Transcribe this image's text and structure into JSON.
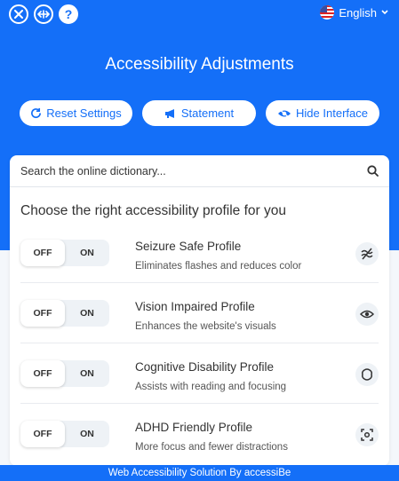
{
  "language": {
    "label": "English"
  },
  "header": {
    "title": "Accessibility Adjustments"
  },
  "actions": {
    "reset_label": "Reset Settings",
    "statement_label": "Statement",
    "hide_label": "Hide Interface"
  },
  "search": {
    "placeholder": "Search the online dictionary..."
  },
  "profiles": {
    "heading": "Choose the right accessibility profile for you",
    "items": [
      {
        "title": "Seizure Safe Profile",
        "description": "Eliminates flashes and reduces color",
        "off_label": "OFF",
        "on_label": "ON",
        "icon": "lightning-off-icon"
      },
      {
        "title": "Vision Impaired Profile",
        "description": "Enhances the website's visuals",
        "off_label": "OFF",
        "on_label": "ON",
        "icon": "eye-icon"
      },
      {
        "title": "Cognitive Disability Profile",
        "description": "Assists with reading and focusing",
        "off_label": "OFF",
        "on_label": "ON",
        "icon": "brain-icon"
      },
      {
        "title": "ADHD Friendly Profile",
        "description": "More focus and fewer distractions",
        "off_label": "OFF",
        "on_label": "ON",
        "icon": "focus-target-icon"
      }
    ]
  },
  "footer": {
    "label": "Web Accessibility Solution By accessiBe"
  },
  "colors": {
    "primary": "#146ff8",
    "text": "#333333",
    "toggle_bg": "#eef2f6"
  }
}
